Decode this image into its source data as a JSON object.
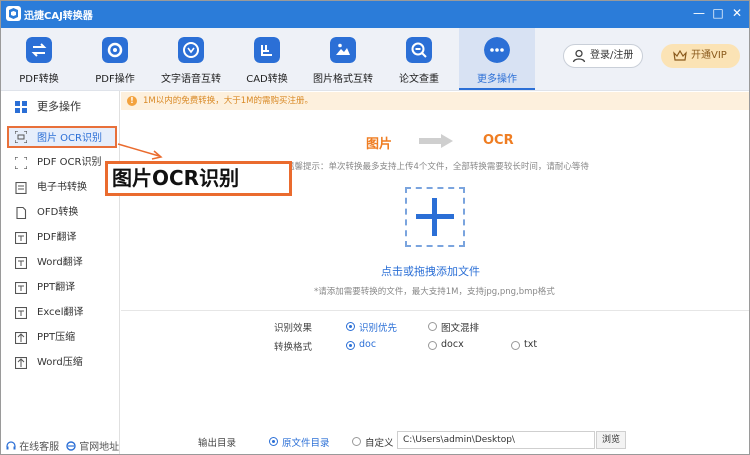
{
  "window": {
    "title": "迅捷CAJ转换器",
    "controls": [
      "—",
      "□",
      "✕"
    ]
  },
  "toolbar": {
    "items": [
      {
        "label": "PDF转换",
        "icon": "swap-icon"
      },
      {
        "label": "PDF操作",
        "icon": "gear-icon"
      },
      {
        "label": "文字语音互转",
        "icon": "speech-icon"
      },
      {
        "label": "CAD转换",
        "icon": "cad-icon"
      },
      {
        "label": "图片格式互转",
        "icon": "image-icon"
      },
      {
        "label": "论文查重",
        "icon": "search-doc-icon"
      },
      {
        "label": "更多操作",
        "icon": "more-icon",
        "active": true
      }
    ],
    "login_label": "登录/注册",
    "vip_label": "开通VIP"
  },
  "sidebar": {
    "header": "更多操作",
    "items": [
      {
        "label": "图片 OCR识别",
        "selected": true
      },
      {
        "label": "PDF OCR识别"
      },
      {
        "label": "电子书转换"
      },
      {
        "label": "OFD转换"
      },
      {
        "label": "PDF翻译"
      },
      {
        "label": "Word翻译"
      },
      {
        "label": "PPT翻译"
      },
      {
        "label": "Excel翻译"
      },
      {
        "label": "PPT压缩"
      },
      {
        "label": "Word压缩"
      }
    ],
    "footer_service": "在线客服",
    "footer_website": "官网地址"
  },
  "notice": "1M以内的免费转换，大于1M的需购买注册。",
  "flow": {
    "from": "图片",
    "to": "OCR"
  },
  "hint_top": "温馨提示：单次转换最多支持上传4个文件，全部转换需要较长时间，请耐心等待",
  "dropzone": {
    "add_text": "点击或拖拽添加文件",
    "hint": "*请添加需要转换的文件，最大支持1M，支持jpg,png,bmp格式"
  },
  "options": {
    "effect_label": "识别效果",
    "effect_options": [
      "识别优先",
      "图文混排"
    ],
    "format_label": "转换格式",
    "format_options": [
      "doc",
      "docx",
      "txt"
    ],
    "output_label": "输出目录",
    "output_options": [
      "原文件目录",
      "自定义"
    ],
    "output_path": "C:\\Users\\admin\\Desktop\\",
    "browse_label": "浏览"
  },
  "callout": "图片OCR识别",
  "colors": {
    "brand_blue": "#2b7cd9",
    "accent_orange": "#ea6b2e",
    "notice_bg": "#fdf0dd"
  }
}
